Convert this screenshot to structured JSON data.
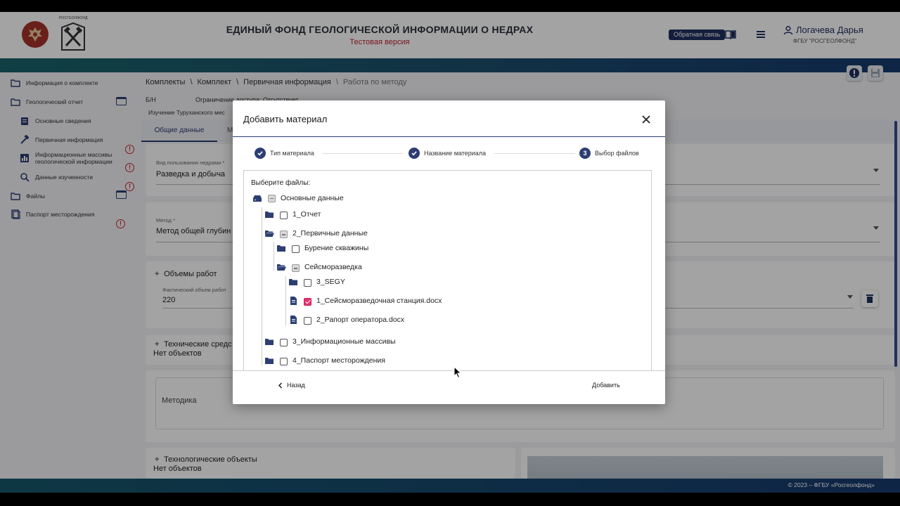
{
  "header": {
    "logo_caption": "РОСГЕОЛФОНД",
    "title": "ЕДИНЫЙ ФОНД ГЕОЛОГИЧЕСКОЙ ИНФОРМАЦИИ О НЕДРАХ",
    "subtitle": "Тестовая версия",
    "feedback_label": "Обратная связь",
    "user_name": "Логачева Дарья",
    "user_org": "ФГБУ \"РОСГЕОЛФОНД\""
  },
  "sidebar": {
    "items": [
      {
        "label": "Информация о комплекте",
        "icon": "folder-icon"
      },
      {
        "label": "Геологический отчет",
        "icon": "folder-icon"
      },
      {
        "label": "Основные сведения",
        "icon": "clipboard-icon"
      },
      {
        "label": "Первичная информация",
        "icon": "hammer-icon"
      },
      {
        "label": "Информационные массивы геологической информации",
        "icon": "chart-icon"
      },
      {
        "label": "Данные изученности",
        "icon": "search-icon"
      },
      {
        "label": "Файлы",
        "icon": "folder-icon"
      },
      {
        "label": "Паспорт месторождения",
        "icon": "document-icon"
      }
    ]
  },
  "breadcrumbs": [
    "Комплекты",
    "Комплект",
    "Первичная информация",
    "Работа по методу"
  ],
  "main": {
    "number": "Б/Н",
    "access": "Ограничение доступа: Отсутствует",
    "study_line": "Изучение Туруханского мес",
    "tabs": [
      "Общие данные",
      "М"
    ],
    "usage_label": "Вид пользования недрами *",
    "usage_value": "Разведка и добыча",
    "method_label": "Метод *",
    "method_value": "Метод общей глубин",
    "volumes_title": "Объемы работ",
    "actual_volume_label": "Фактический объем работ",
    "actual_volume_value": "220",
    "tech_means_title": "Технические средс",
    "no_objects_1": "Нет объектов",
    "methodology_label": "Методика",
    "tech_objects_title": "Технологические объекты",
    "no_objects_2": "Нет объектов"
  },
  "modal": {
    "title": "Добавить материал",
    "steps": [
      {
        "label": "Тип материала",
        "state": "done"
      },
      {
        "label": "Название материала",
        "state": "done"
      },
      {
        "label": "Выбор файлов",
        "state": "active",
        "number": "3"
      }
    ],
    "tree_heading": "Выберите файлы:",
    "tree": [
      {
        "label": "Основные данные",
        "type": "root",
        "state": "partial"
      },
      {
        "label": "1_Отчет",
        "type": "folder",
        "state": "unchecked"
      },
      {
        "label": "2_Первичные данные",
        "type": "folder-open",
        "state": "partial"
      },
      {
        "label": "Бурение скважины",
        "type": "folder",
        "state": "unchecked"
      },
      {
        "label": "Сейсморазведка",
        "type": "folder-open",
        "state": "partial"
      },
      {
        "label": "3_SEGY",
        "type": "folder",
        "state": "unchecked"
      },
      {
        "label": "1_Сейсморазведочная станция.docx",
        "type": "file",
        "state": "checked"
      },
      {
        "label": "2_Рапорт оператора.docx",
        "type": "file",
        "state": "unchecked"
      },
      {
        "label": "3_Информационные массивы",
        "type": "folder",
        "state": "unchecked"
      },
      {
        "label": "4_Паспорт месторождения",
        "type": "folder",
        "state": "unchecked"
      }
    ],
    "back_label": "Назад",
    "add_label": "Добавить"
  },
  "footer": {
    "copyright": "© 2023 – ФГБУ «Росгеолфонд»"
  },
  "colors": {
    "primary": "#2c3e73",
    "alert": "#c8252e",
    "checked": "#e6336e"
  }
}
